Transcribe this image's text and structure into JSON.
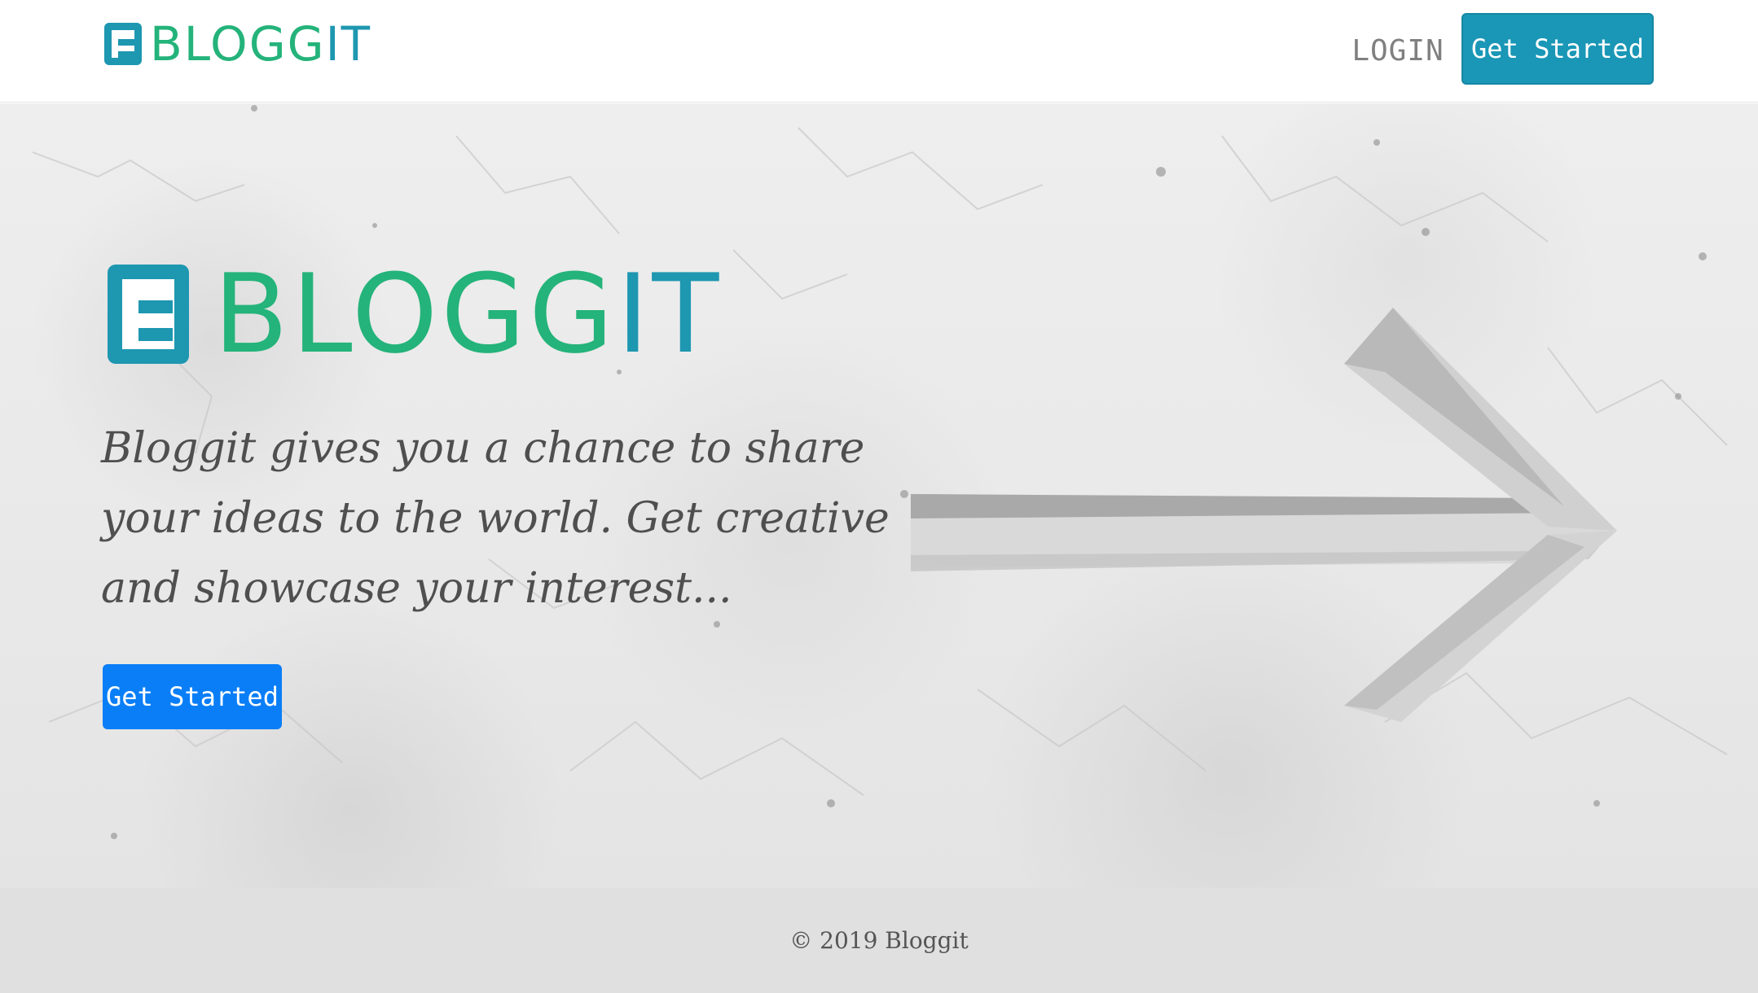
{
  "brand": {
    "name_main": "BLOGG",
    "name_tail": "IT",
    "colors": {
      "green": "#24b37a",
      "teal": "#1e97b0"
    }
  },
  "nav": {
    "login_label": "LOGIN",
    "cta_label": "Get Started",
    "cta_color": "#1a97b6"
  },
  "hero": {
    "tagline": "Bloggit gives you a chance to share your ideas to the world. Get creative and showcase your interest...",
    "cta_label": "Get Started",
    "cta_color": "#0a7ef7",
    "background_icon": "arrow-right-icon"
  },
  "footer": {
    "copyright": "© 2019 Bloggit"
  }
}
